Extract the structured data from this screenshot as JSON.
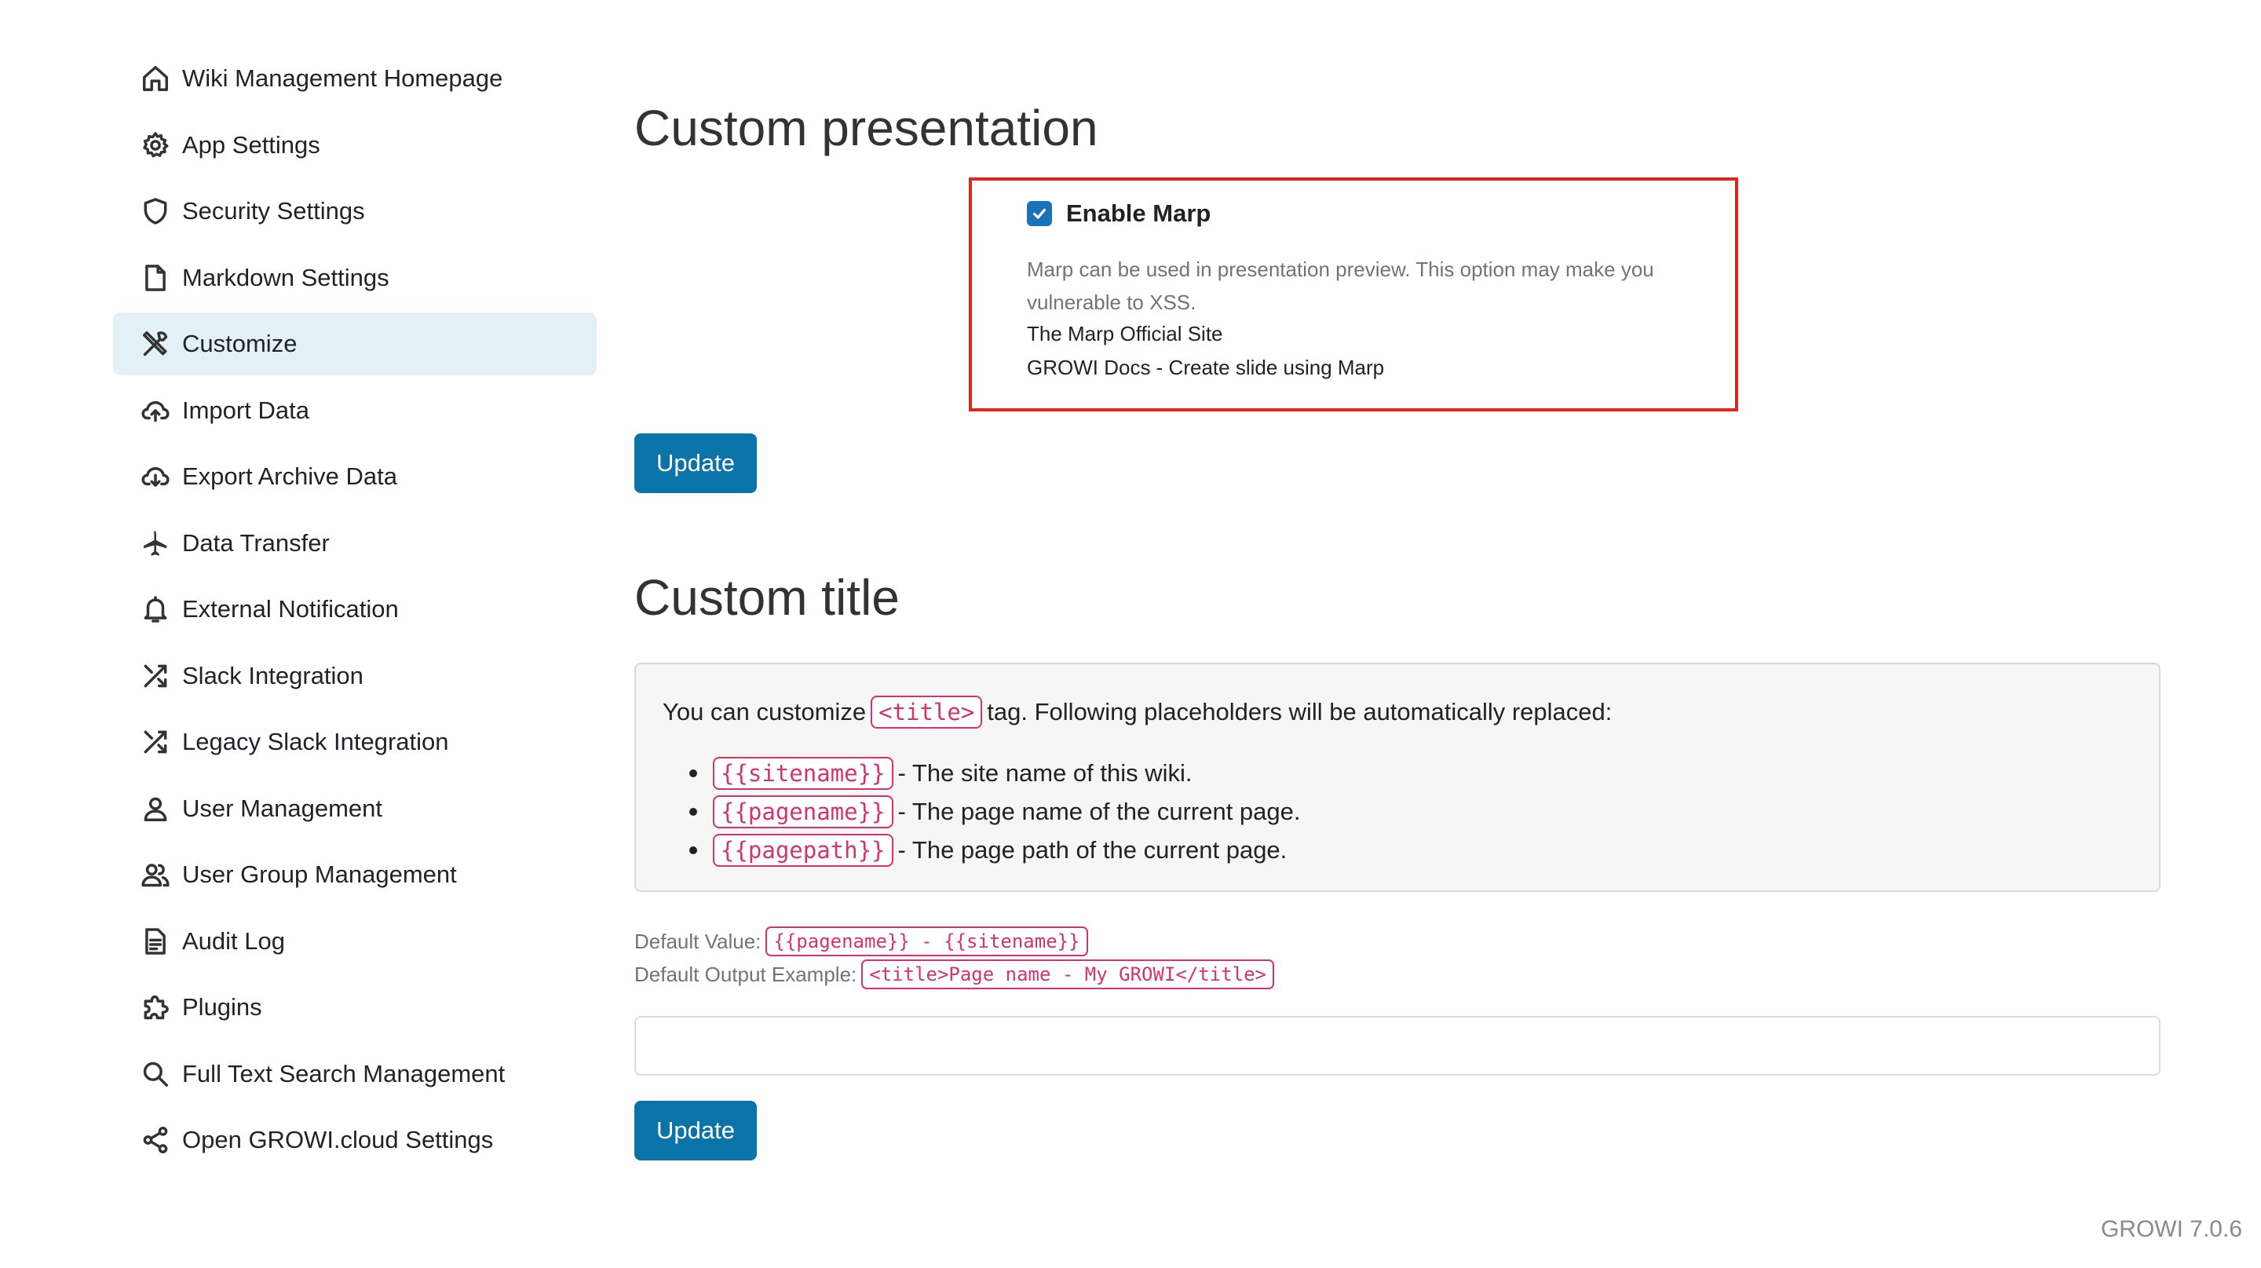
{
  "sidebar": {
    "items": [
      {
        "label": "Wiki Management Homepage",
        "icon": "home-icon",
        "active": false
      },
      {
        "label": "App Settings",
        "icon": "gear-icon",
        "active": false
      },
      {
        "label": "Security Settings",
        "icon": "shield-icon",
        "active": false
      },
      {
        "label": "Markdown Settings",
        "icon": "file-icon",
        "active": false
      },
      {
        "label": "Customize",
        "icon": "tools-icon",
        "active": true
      },
      {
        "label": "Import Data",
        "icon": "cloud-upload-icon",
        "active": false
      },
      {
        "label": "Export Archive Data",
        "icon": "cloud-download-icon",
        "active": false
      },
      {
        "label": "Data Transfer",
        "icon": "airplane-icon",
        "active": false
      },
      {
        "label": "External Notification",
        "icon": "bell-icon",
        "active": false
      },
      {
        "label": "Slack Integration",
        "icon": "shuffle-icon",
        "active": false
      },
      {
        "label": "Legacy Slack Integration",
        "icon": "shuffle-icon",
        "active": false
      },
      {
        "label": "User Management",
        "icon": "user-icon",
        "active": false
      },
      {
        "label": "User Group Management",
        "icon": "users-icon",
        "active": false
      },
      {
        "label": "Audit Log",
        "icon": "document-icon",
        "active": false
      },
      {
        "label": "Plugins",
        "icon": "puzzle-icon",
        "active": false
      },
      {
        "label": "Full Text Search Management",
        "icon": "search-icon",
        "active": false
      },
      {
        "label": "Open GROWI.cloud Settings",
        "icon": "share-icon",
        "active": false
      }
    ]
  },
  "presentation": {
    "title": "Custom presentation",
    "checkbox_label": "Enable Marp",
    "checked": true,
    "description": "Marp can be used in presentation preview. This option may make you vulnerable to XSS.",
    "link1": "The Marp Official Site",
    "link2": "GROWI Docs - Create slide using Marp",
    "update_label": "Update",
    "highlight_color": "#e0261b"
  },
  "custom_title": {
    "title": "Custom title",
    "info_prefix": "You can customize",
    "info_tag": "<title>",
    "info_suffix": "tag. Following placeholders will be automatically replaced:",
    "placeholders": [
      {
        "code": "{{sitename}}",
        "text": "- The site name of this wiki."
      },
      {
        "code": "{{pagename}}",
        "text": "- The page name of the current page."
      },
      {
        "code": "{{pagepath}}",
        "text": "- The page path of the current page."
      }
    ],
    "default_value_label": "Default Value:",
    "default_value": "{{pagename}} - {{sitename}}",
    "default_output_label": "Default Output Example:",
    "default_output": "<title>Page name - My GROWI</title>",
    "input_value": "",
    "update_label": "Update"
  },
  "version": "GROWI 7.0.6",
  "colors": {
    "accent": "#0a74a8",
    "code": "#d6336c",
    "active_bg": "#e3f0f6"
  }
}
